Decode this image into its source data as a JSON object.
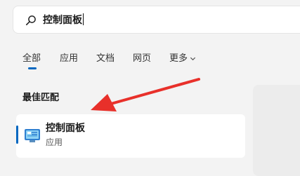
{
  "search": {
    "query": "控制面板"
  },
  "tabs": [
    {
      "label": "全部"
    },
    {
      "label": "应用"
    },
    {
      "label": "文档"
    },
    {
      "label": "网页"
    },
    {
      "label": "更多"
    }
  ],
  "best_match": {
    "heading": "最佳匹配",
    "title": "控制面板",
    "subtitle": "应用"
  },
  "icons": {
    "search": "search-icon",
    "more_chevron": "chevron-down-icon",
    "app": "control-panel-icon",
    "annotation": "red-arrow-annotation"
  },
  "colors": {
    "accent": "#0067c0",
    "annotation_red": "#e8302a"
  }
}
